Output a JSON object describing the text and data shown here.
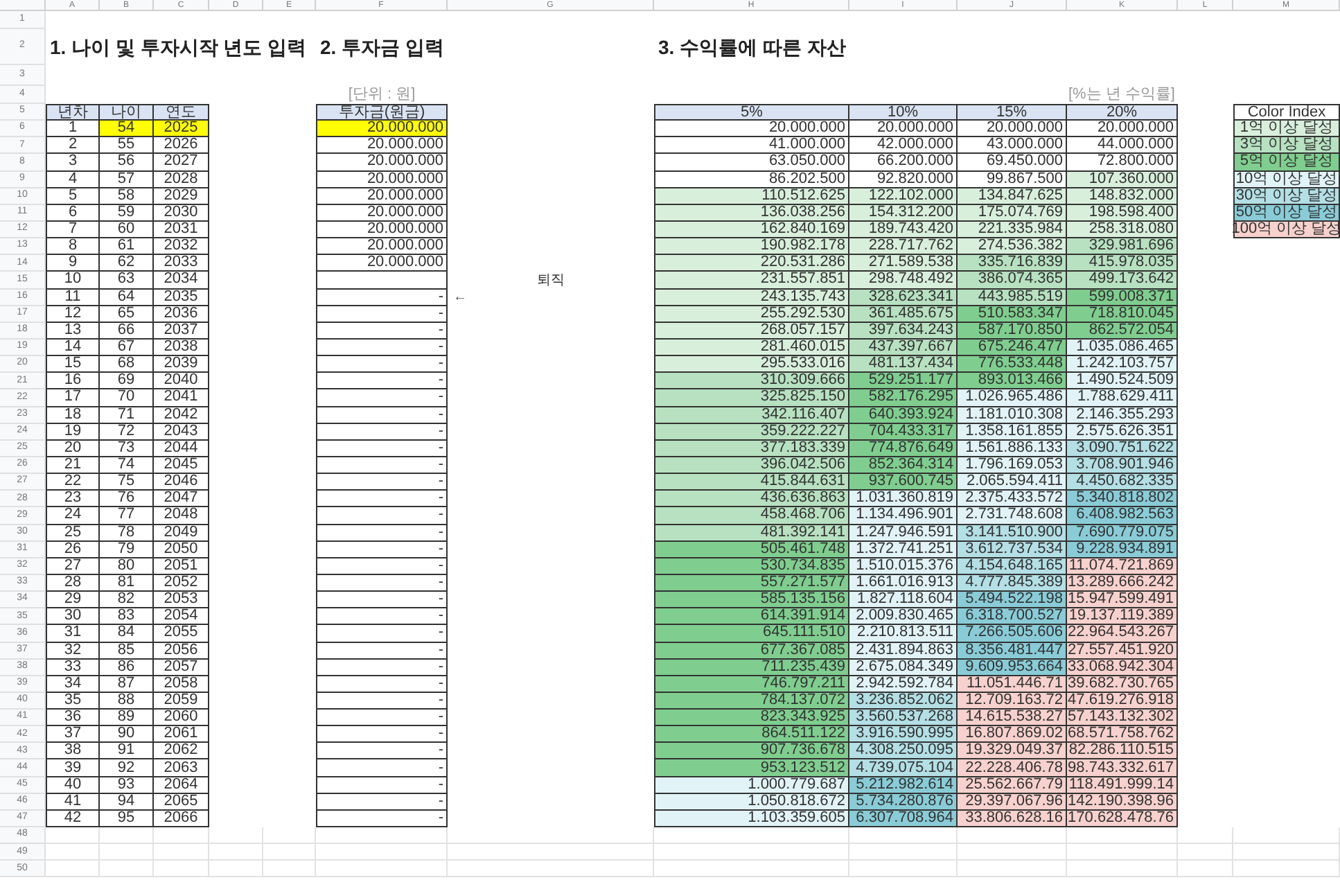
{
  "column_letters": [
    "A",
    "B",
    "C",
    "D",
    "E",
    "F",
    "G",
    "H",
    "I",
    "J",
    "K",
    "L",
    "M"
  ],
  "row_numbers": [
    "1",
    "2",
    "3",
    "4",
    "5",
    "6",
    "7",
    "8",
    "9",
    "10",
    "11",
    "12",
    "13",
    "14",
    "15",
    "16",
    "17",
    "18",
    "19",
    "20",
    "21",
    "22",
    "23",
    "24",
    "25",
    "26",
    "27",
    "28",
    "29",
    "30",
    "31",
    "32",
    "33",
    "34",
    "35",
    "36",
    "37",
    "38",
    "39",
    "40",
    "41",
    "42",
    "43",
    "44",
    "45",
    "46",
    "47",
    "48",
    "49",
    "50"
  ],
  "section_1": {
    "title": "1. 나이 및 투자시작 년도 입력",
    "columns": [
      "년차",
      "나이",
      "연도"
    ],
    "rows": [
      {
        "year_no": "1",
        "age": "54",
        "year": "2025",
        "highlighted": true
      },
      {
        "year_no": "2",
        "age": "55",
        "year": "2026",
        "highlighted": false
      },
      {
        "year_no": "3",
        "age": "56",
        "year": "2027",
        "highlighted": false
      },
      {
        "year_no": "4",
        "age": "57",
        "year": "2028",
        "highlighted": false
      },
      {
        "year_no": "5",
        "age": "58",
        "year": "2029",
        "highlighted": false
      },
      {
        "year_no": "6",
        "age": "59",
        "year": "2030",
        "highlighted": false
      },
      {
        "year_no": "7",
        "age": "60",
        "year": "2031",
        "highlighted": false
      },
      {
        "year_no": "8",
        "age": "61",
        "year": "2032",
        "highlighted": false
      },
      {
        "year_no": "9",
        "age": "62",
        "year": "2033",
        "highlighted": false
      },
      {
        "year_no": "10",
        "age": "63",
        "year": "2034",
        "highlighted": false
      },
      {
        "year_no": "11",
        "age": "64",
        "year": "2035",
        "highlighted": false
      },
      {
        "year_no": "12",
        "age": "65",
        "year": "2036",
        "highlighted": false
      },
      {
        "year_no": "13",
        "age": "66",
        "year": "2037",
        "highlighted": false
      },
      {
        "year_no": "14",
        "age": "67",
        "year": "2038",
        "highlighted": false
      },
      {
        "year_no": "15",
        "age": "68",
        "year": "2039",
        "highlighted": false
      },
      {
        "year_no": "16",
        "age": "69",
        "year": "2040",
        "highlighted": false
      },
      {
        "year_no": "17",
        "age": "70",
        "year": "2041",
        "highlighted": false
      },
      {
        "year_no": "18",
        "age": "71",
        "year": "2042",
        "highlighted": false
      },
      {
        "year_no": "19",
        "age": "72",
        "year": "2043",
        "highlighted": false
      },
      {
        "year_no": "20",
        "age": "73",
        "year": "2044",
        "highlighted": false
      },
      {
        "year_no": "21",
        "age": "74",
        "year": "2045",
        "highlighted": false
      },
      {
        "year_no": "22",
        "age": "75",
        "year": "2046",
        "highlighted": false
      },
      {
        "year_no": "23",
        "age": "76",
        "year": "2047",
        "highlighted": false
      },
      {
        "year_no": "24",
        "age": "77",
        "year": "2048",
        "highlighted": false
      },
      {
        "year_no": "25",
        "age": "78",
        "year": "2049",
        "highlighted": false
      },
      {
        "year_no": "26",
        "age": "79",
        "year": "2050",
        "highlighted": false
      },
      {
        "year_no": "27",
        "age": "80",
        "year": "2051",
        "highlighted": false
      },
      {
        "year_no": "28",
        "age": "81",
        "year": "2052",
        "highlighted": false
      },
      {
        "year_no": "29",
        "age": "82",
        "year": "2053",
        "highlighted": false
      },
      {
        "year_no": "30",
        "age": "83",
        "year": "2054",
        "highlighted": false
      },
      {
        "year_no": "31",
        "age": "84",
        "year": "2055",
        "highlighted": false
      },
      {
        "year_no": "32",
        "age": "85",
        "year": "2056",
        "highlighted": false
      },
      {
        "year_no": "33",
        "age": "86",
        "year": "2057",
        "highlighted": false
      },
      {
        "year_no": "34",
        "age": "87",
        "year": "2058",
        "highlighted": false
      },
      {
        "year_no": "35",
        "age": "88",
        "year": "2059",
        "highlighted": false
      },
      {
        "year_no": "36",
        "age": "89",
        "year": "2060",
        "highlighted": false
      },
      {
        "year_no": "37",
        "age": "90",
        "year": "2061",
        "highlighted": false
      },
      {
        "year_no": "38",
        "age": "91",
        "year": "2062",
        "highlighted": false
      },
      {
        "year_no": "39",
        "age": "92",
        "year": "2063",
        "highlighted": false
      },
      {
        "year_no": "40",
        "age": "93",
        "year": "2064",
        "highlighted": false
      },
      {
        "year_no": "41",
        "age": "94",
        "year": "2065",
        "highlighted": false
      },
      {
        "year_no": "42",
        "age": "95",
        "year": "2066",
        "highlighted": false
      }
    ]
  },
  "section_2": {
    "title": "2. 투자금 입력",
    "unit_note": "[단위 : 원]",
    "column": "투자금(원금)",
    "retirement_label": "퇴직",
    "retirement_arrow": "←",
    "rows": [
      {
        "amount": "20.000.000",
        "highlighted": true
      },
      {
        "amount": "20.000.000",
        "highlighted": false
      },
      {
        "amount": "20.000.000",
        "highlighted": false
      },
      {
        "amount": "20.000.000",
        "highlighted": false
      },
      {
        "amount": "20.000.000",
        "highlighted": false
      },
      {
        "amount": "20.000.000",
        "highlighted": false
      },
      {
        "amount": "20.000.000",
        "highlighted": false
      },
      {
        "amount": "20.000.000",
        "highlighted": false
      },
      {
        "amount": "20.000.000",
        "highlighted": false
      },
      {
        "highlighted": false
      },
      {
        "amount": "-",
        "highlighted": false
      },
      {
        "amount": "-",
        "highlighted": false
      },
      {
        "amount": "-",
        "highlighted": false
      },
      {
        "amount": "-",
        "highlighted": false
      },
      {
        "amount": "-",
        "highlighted": false
      },
      {
        "amount": "-",
        "highlighted": false
      },
      {
        "amount": "-",
        "highlighted": false
      },
      {
        "amount": "-",
        "highlighted": false
      },
      {
        "amount": "-",
        "highlighted": false
      },
      {
        "amount": "-",
        "highlighted": false
      },
      {
        "amount": "-",
        "highlighted": false
      },
      {
        "amount": "-",
        "highlighted": false
      },
      {
        "amount": "-",
        "highlighted": false
      },
      {
        "amount": "-",
        "highlighted": false
      },
      {
        "amount": "-",
        "highlighted": false
      },
      {
        "amount": "-",
        "highlighted": false
      },
      {
        "amount": "-",
        "highlighted": false
      },
      {
        "amount": "-",
        "highlighted": false
      },
      {
        "amount": "-",
        "highlighted": false
      },
      {
        "amount": "-",
        "highlighted": false
      },
      {
        "amount": "-",
        "highlighted": false
      },
      {
        "amount": "-",
        "highlighted": false
      },
      {
        "amount": "-",
        "highlighted": false
      },
      {
        "amount": "-",
        "highlighted": false
      },
      {
        "amount": "-",
        "highlighted": false
      },
      {
        "amount": "-",
        "highlighted": false
      },
      {
        "amount": "-",
        "highlighted": false
      },
      {
        "amount": "-",
        "highlighted": false
      },
      {
        "amount": "-",
        "highlighted": false
      },
      {
        "amount": "-",
        "highlighted": false
      },
      {
        "amount": "-",
        "highlighted": false
      },
      {
        "amount": "-",
        "highlighted": false
      }
    ]
  },
  "section_3": {
    "title": "3. 수익률에 따른 자산",
    "unit_note": "[%는 년 수익률]",
    "columns": [
      "5%",
      "10%",
      "15%",
      "20%"
    ],
    "rows": [
      {
        "cells": [
          {
            "text": "20.000.000",
            "color": "#ffffff"
          },
          {
            "text": "20.000.000",
            "color": "#ffffff"
          },
          {
            "text": "20.000.000",
            "color": "#ffffff"
          },
          {
            "text": "20.000.000",
            "color": "#ffffff"
          }
        ]
      },
      {
        "cells": [
          {
            "text": "41.000.000",
            "color": "#ffffff"
          },
          {
            "text": "42.000.000",
            "color": "#ffffff"
          },
          {
            "text": "43.000.000",
            "color": "#ffffff"
          },
          {
            "text": "44.000.000",
            "color": "#ffffff"
          }
        ]
      },
      {
        "cells": [
          {
            "text": "63.050.000",
            "color": "#ffffff"
          },
          {
            "text": "66.200.000",
            "color": "#ffffff"
          },
          {
            "text": "69.450.000",
            "color": "#ffffff"
          },
          {
            "text": "72.800.000",
            "color": "#ffffff"
          }
        ]
      },
      {
        "cells": [
          {
            "text": "86.202.500",
            "color": "#ffffff"
          },
          {
            "text": "92.820.000",
            "color": "#ffffff"
          },
          {
            "text": "99.867.500",
            "color": "#ffffff"
          },
          {
            "text": "107.360.000",
            "color": "#d8efdc"
          }
        ]
      },
      {
        "cells": [
          {
            "text": "110.512.625",
            "color": "#d8efdc"
          },
          {
            "text": "122.102.000",
            "color": "#d8efdc"
          },
          {
            "text": "134.847.625",
            "color": "#d8efdc"
          },
          {
            "text": "148.832.000",
            "color": "#d8efdc"
          }
        ]
      },
      {
        "cells": [
          {
            "text": "136.038.256",
            "color": "#d8efdc"
          },
          {
            "text": "154.312.200",
            "color": "#d8efdc"
          },
          {
            "text": "175.074.769",
            "color": "#d8efdc"
          },
          {
            "text": "198.598.400",
            "color": "#d8efdc"
          }
        ]
      },
      {
        "cells": [
          {
            "text": "162.840.169",
            "color": "#d8efdc"
          },
          {
            "text": "189.743.420",
            "color": "#d8efdc"
          },
          {
            "text": "221.335.984",
            "color": "#d8efdc"
          },
          {
            "text": "258.318.080",
            "color": "#d8efdc"
          }
        ]
      },
      {
        "cells": [
          {
            "text": "190.982.178",
            "color": "#d8efdc"
          },
          {
            "text": "228.717.762",
            "color": "#d8efdc"
          },
          {
            "text": "274.536.382",
            "color": "#d8efdc"
          },
          {
            "text": "329.981.696",
            "color": "#b7e1c0"
          }
        ]
      },
      {
        "cells": [
          {
            "text": "220.531.286",
            "color": "#d8efdc"
          },
          {
            "text": "271.589.538",
            "color": "#d8efdc"
          },
          {
            "text": "335.716.839",
            "color": "#b7e1c0"
          },
          {
            "text": "415.978.035",
            "color": "#b7e1c0"
          }
        ]
      },
      {
        "cells": [
          {
            "text": "231.557.851",
            "color": "#d8efdc"
          },
          {
            "text": "298.748.492",
            "color": "#d8efdc"
          },
          {
            "text": "386.074.365",
            "color": "#b7e1c0"
          },
          {
            "text": "499.173.642",
            "color": "#b7e1c0"
          }
        ]
      },
      {
        "cells": [
          {
            "text": "243.135.743",
            "color": "#d8efdc"
          },
          {
            "text": "328.623.341",
            "color": "#b7e1c0"
          },
          {
            "text": "443.985.519",
            "color": "#b7e1c0"
          },
          {
            "text": "599.008.371",
            "color": "#7fce8f"
          }
        ]
      },
      {
        "cells": [
          {
            "text": "255.292.530",
            "color": "#d8efdc"
          },
          {
            "text": "361.485.675",
            "color": "#b7e1c0"
          },
          {
            "text": "510.583.347",
            "color": "#7fce8f"
          },
          {
            "text": "718.810.045",
            "color": "#7fce8f"
          }
        ]
      },
      {
        "cells": [
          {
            "text": "268.057.157",
            "color": "#d8efdc"
          },
          {
            "text": "397.634.243",
            "color": "#b7e1c0"
          },
          {
            "text": "587.170.850",
            "color": "#7fce8f"
          },
          {
            "text": "862.572.054",
            "color": "#7fce8f"
          }
        ]
      },
      {
        "cells": [
          {
            "text": "281.460.015",
            "color": "#d8efdc"
          },
          {
            "text": "437.397.667",
            "color": "#b7e1c0"
          },
          {
            "text": "675.246.477",
            "color": "#7fce8f"
          },
          {
            "text": "1.035.086.465",
            "color": "#e1f3f6"
          }
        ]
      },
      {
        "cells": [
          {
            "text": "295.533.016",
            "color": "#d8efdc"
          },
          {
            "text": "481.137.434",
            "color": "#b7e1c0"
          },
          {
            "text": "776.533.448",
            "color": "#7fce8f"
          },
          {
            "text": "1.242.103.757",
            "color": "#e1f3f6"
          }
        ]
      },
      {
        "cells": [
          {
            "text": "310.309.666",
            "color": "#b7e1c0"
          },
          {
            "text": "529.251.177",
            "color": "#7fce8f"
          },
          {
            "text": "893.013.466",
            "color": "#7fce8f"
          },
          {
            "text": "1.490.524.509",
            "color": "#e1f3f6"
          }
        ]
      },
      {
        "cells": [
          {
            "text": "325.825.150",
            "color": "#b7e1c0"
          },
          {
            "text": "582.176.295",
            "color": "#7fce8f"
          },
          {
            "text": "1.026.965.486",
            "color": "#e1f3f6"
          },
          {
            "text": "1.788.629.411",
            "color": "#e1f3f6"
          }
        ]
      },
      {
        "cells": [
          {
            "text": "342.116.407",
            "color": "#b7e1c0"
          },
          {
            "text": "640.393.924",
            "color": "#7fce8f"
          },
          {
            "text": "1.181.010.308",
            "color": "#e1f3f6"
          },
          {
            "text": "2.146.355.293",
            "color": "#e1f3f6"
          }
        ]
      },
      {
        "cells": [
          {
            "text": "359.222.227",
            "color": "#b7e1c0"
          },
          {
            "text": "704.433.317",
            "color": "#7fce8f"
          },
          {
            "text": "1.358.161.855",
            "color": "#e1f3f6"
          },
          {
            "text": "2.575.626.351",
            "color": "#e1f3f6"
          }
        ]
      },
      {
        "cells": [
          {
            "text": "377.183.339",
            "color": "#b7e1c0"
          },
          {
            "text": "774.876.649",
            "color": "#7fce8f"
          },
          {
            "text": "1.561.886.133",
            "color": "#e1f3f6"
          },
          {
            "text": "3.090.751.622",
            "color": "#b3dfe5"
          }
        ]
      },
      {
        "cells": [
          {
            "text": "396.042.506",
            "color": "#b7e1c0"
          },
          {
            "text": "852.364.314",
            "color": "#7fce8f"
          },
          {
            "text": "1.796.169.053",
            "color": "#e1f3f6"
          },
          {
            "text": "3.708.901.946",
            "color": "#b3dfe5"
          }
        ]
      },
      {
        "cells": [
          {
            "text": "415.844.631",
            "color": "#b7e1c0"
          },
          {
            "text": "937.600.745",
            "color": "#7fce8f"
          },
          {
            "text": "2.065.594.411",
            "color": "#e1f3f6"
          },
          {
            "text": "4.450.682.335",
            "color": "#b3dfe5"
          }
        ]
      },
      {
        "cells": [
          {
            "text": "436.636.863",
            "color": "#b7e1c0"
          },
          {
            "text": "1.031.360.819",
            "color": "#e1f3f6"
          },
          {
            "text": "2.375.433.572",
            "color": "#e1f3f6"
          },
          {
            "text": "5.340.818.802",
            "color": "#89ccd7"
          }
        ]
      },
      {
        "cells": [
          {
            "text": "458.468.706",
            "color": "#b7e1c0"
          },
          {
            "text": "1.134.496.901",
            "color": "#e1f3f6"
          },
          {
            "text": "2.731.748.608",
            "color": "#e1f3f6"
          },
          {
            "text": "6.408.982.563",
            "color": "#89ccd7"
          }
        ]
      },
      {
        "cells": [
          {
            "text": "481.392.141",
            "color": "#b7e1c0"
          },
          {
            "text": "1.247.946.591",
            "color": "#e1f3f6"
          },
          {
            "text": "3.141.510.900",
            "color": "#b3dfe5"
          },
          {
            "text": "7.690.779.075",
            "color": "#89ccd7"
          }
        ]
      },
      {
        "cells": [
          {
            "text": "505.461.748",
            "color": "#7fce8f"
          },
          {
            "text": "1.372.741.251",
            "color": "#e1f3f6"
          },
          {
            "text": "3.612.737.534",
            "color": "#b3dfe5"
          },
          {
            "text": "9.228.934.891",
            "color": "#89ccd7"
          }
        ]
      },
      {
        "cells": [
          {
            "text": "530.734.835",
            "color": "#7fce8f"
          },
          {
            "text": "1.510.015.376",
            "color": "#e1f3f6"
          },
          {
            "text": "4.154.648.165",
            "color": "#b3dfe5"
          },
          {
            "text": "11.074.721.869",
            "color": "#f7d1cd"
          }
        ]
      },
      {
        "cells": [
          {
            "text": "557.271.577",
            "color": "#7fce8f"
          },
          {
            "text": "1.661.016.913",
            "color": "#e1f3f6"
          },
          {
            "text": "4.777.845.389",
            "color": "#b3dfe5"
          },
          {
            "text": "13.289.666.242",
            "color": "#f7d1cd"
          }
        ]
      },
      {
        "cells": [
          {
            "text": "585.135.156",
            "color": "#7fce8f"
          },
          {
            "text": "1.827.118.604",
            "color": "#e1f3f6"
          },
          {
            "text": "5.494.522.198",
            "color": "#89ccd7"
          },
          {
            "text": "15.947.599.491",
            "color": "#f7d1cd"
          }
        ]
      },
      {
        "cells": [
          {
            "text": "614.391.914",
            "color": "#7fce8f"
          },
          {
            "text": "2.009.830.465",
            "color": "#e1f3f6"
          },
          {
            "text": "6.318.700.527",
            "color": "#89ccd7"
          },
          {
            "text": "19.137.119.389",
            "color": "#f7d1cd"
          }
        ]
      },
      {
        "cells": [
          {
            "text": "645.111.510",
            "color": "#7fce8f"
          },
          {
            "text": "2.210.813.511",
            "color": "#e1f3f6"
          },
          {
            "text": "7.266.505.606",
            "color": "#89ccd7"
          },
          {
            "text": "22.964.543.267",
            "color": "#f7d1cd"
          }
        ]
      },
      {
        "cells": [
          {
            "text": "677.367.085",
            "color": "#7fce8f"
          },
          {
            "text": "2.431.894.863",
            "color": "#e1f3f6"
          },
          {
            "text": "8.356.481.447",
            "color": "#89ccd7"
          },
          {
            "text": "27.557.451.920",
            "color": "#f7d1cd"
          }
        ]
      },
      {
        "cells": [
          {
            "text": "711.235.439",
            "color": "#7fce8f"
          },
          {
            "text": "2.675.084.349",
            "color": "#e1f3f6"
          },
          {
            "text": "9.609.953.664",
            "color": "#89ccd7"
          },
          {
            "text": "33.068.942.304",
            "color": "#f7d1cd"
          }
        ]
      },
      {
        "cells": [
          {
            "text": "746.797.211",
            "color": "#7fce8f"
          },
          {
            "text": "2.942.592.784",
            "color": "#e1f3f6"
          },
          {
            "text": "11.051.446.71",
            "color": "#f7d1cd"
          },
          {
            "text": "39.682.730.765",
            "color": "#f7d1cd"
          }
        ]
      },
      {
        "cells": [
          {
            "text": "784.137.072",
            "color": "#7fce8f"
          },
          {
            "text": "3.236.852.062",
            "color": "#b3dfe5"
          },
          {
            "text": "12.709.163.72",
            "color": "#f7d1cd"
          },
          {
            "text": "47.619.276.918",
            "color": "#f7d1cd"
          }
        ]
      },
      {
        "cells": [
          {
            "text": "823.343.925",
            "color": "#7fce8f"
          },
          {
            "text": "3.560.537.268",
            "color": "#b3dfe5"
          },
          {
            "text": "14.615.538.27",
            "color": "#f7d1cd"
          },
          {
            "text": "57.143.132.302",
            "color": "#f7d1cd"
          }
        ]
      },
      {
        "cells": [
          {
            "text": "864.511.122",
            "color": "#7fce8f"
          },
          {
            "text": "3.916.590.995",
            "color": "#b3dfe5"
          },
          {
            "text": "16.807.869.02",
            "color": "#f7d1cd"
          },
          {
            "text": "68.571.758.762",
            "color": "#f7d1cd"
          }
        ]
      },
      {
        "cells": [
          {
            "text": "907.736.678",
            "color": "#7fce8f"
          },
          {
            "text": "4.308.250.095",
            "color": "#b3dfe5"
          },
          {
            "text": "19.329.049.37",
            "color": "#f7d1cd"
          },
          {
            "text": "82.286.110.515",
            "color": "#f7d1cd"
          }
        ]
      },
      {
        "cells": [
          {
            "text": "953.123.512",
            "color": "#7fce8f"
          },
          {
            "text": "4.739.075.104",
            "color": "#b3dfe5"
          },
          {
            "text": "22.228.406.78",
            "color": "#f7d1cd"
          },
          {
            "text": "98.743.332.617",
            "color": "#f7d1cd"
          }
        ]
      },
      {
        "cells": [
          {
            "text": "1.000.779.687",
            "color": "#e1f3f6"
          },
          {
            "text": "5.212.982.614",
            "color": "#89ccd7"
          },
          {
            "text": "25.562.667.79",
            "color": "#f7d1cd"
          },
          {
            "text": "118.491.999.14",
            "color": "#f7d1cd"
          }
        ]
      },
      {
        "cells": [
          {
            "text": "1.050.818.672",
            "color": "#e1f3f6"
          },
          {
            "text": "5.734.280.876",
            "color": "#89ccd7"
          },
          {
            "text": "29.397.067.96",
            "color": "#f7d1cd"
          },
          {
            "text": "142.190.398.96",
            "color": "#f7d1cd"
          }
        ]
      },
      {
        "cells": [
          {
            "text": "1.103.359.605",
            "color": "#e1f3f6"
          },
          {
            "text": "6.307.708.964",
            "color": "#89ccd7"
          },
          {
            "text": "33.806.628.16",
            "color": "#f7d1cd"
          },
          {
            "text": "170.628.478.76",
            "color": "#f7d1cd"
          }
        ]
      }
    ]
  },
  "color_index": {
    "title": "Color Index",
    "items": [
      {
        "label": "1억 이상 달성",
        "color": "#d8efdc"
      },
      {
        "label": "3억 이상 달성",
        "color": "#b7e1c0"
      },
      {
        "label": "5억 이상 달성",
        "color": "#7fce8f"
      },
      {
        "label": "10억 이상 달성",
        "color": "#e1f3f6"
      },
      {
        "label": "30억 이상 달성",
        "color": "#b3dfe5"
      },
      {
        "label": "50억 이상 달성",
        "color": "#89ccd7"
      },
      {
        "label": "100억 이상 달성",
        "color": "#f7d1cd"
      }
    ]
  }
}
